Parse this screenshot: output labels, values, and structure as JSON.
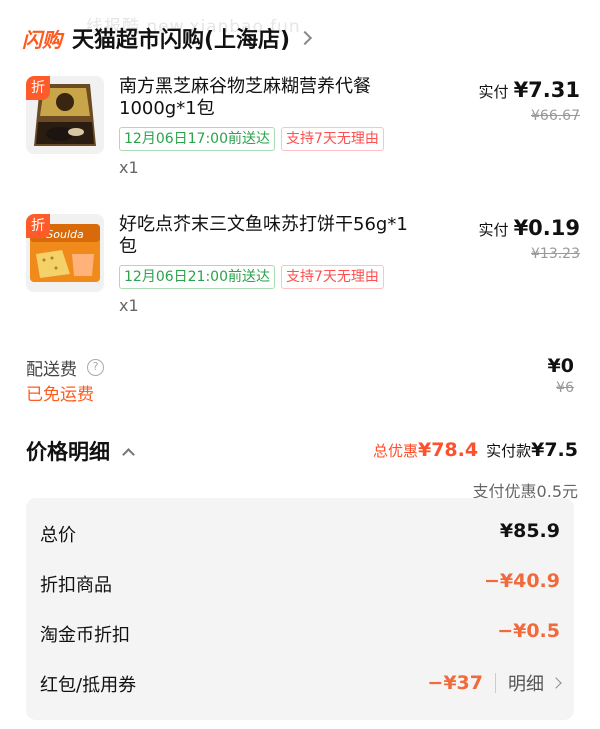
{
  "watermark": "线报酷 new.xianbao.fun",
  "store": {
    "flash_badge": "闪购",
    "name": "天猫超市闪购(上海店)"
  },
  "products": [
    {
      "discount_tag": "折",
      "title": "南方黑芝麻谷物芝麻糊营养代餐1000g*1包",
      "delivery_tag": "12月06日17:00前送达",
      "return_tag": "支持7天无理由",
      "quantity": "x1",
      "paid_label": "实付",
      "paid_price": "¥7.31",
      "original_price": "¥66.67"
    },
    {
      "discount_tag": "折",
      "title": "好吃点芥末三文鱼味苏打饼干56g*1包",
      "delivery_tag": "12月06日21:00前送达",
      "return_tag": "支持7天无理由",
      "quantity": "x1",
      "paid_label": "实付",
      "paid_price": "¥0.19",
      "original_price": "¥13.23"
    }
  ],
  "shipping": {
    "label": "配送费",
    "help_icon": "?",
    "free_label": "已免运费",
    "price": "¥0",
    "original_price": "¥6"
  },
  "price_detail": {
    "title": "价格明细",
    "total_discount_label": "总优惠",
    "total_discount_value": "¥78.4",
    "pay_label": "实付款",
    "pay_value": "¥7.5",
    "payment_discount": "支付优惠0.5元",
    "rows": [
      {
        "label": "总价",
        "value": "¥85.9"
      },
      {
        "label": "折扣商品",
        "value": "−¥40.9"
      },
      {
        "label": "淘金币折扣",
        "value": "−¥0.5"
      },
      {
        "label": "红包/抵用券",
        "value": "−¥37",
        "link": "明细"
      }
    ]
  },
  "colors": {
    "accent": "#ff5a1f",
    "discount": "#f06a3c",
    "green": "#2ba24c"
  }
}
